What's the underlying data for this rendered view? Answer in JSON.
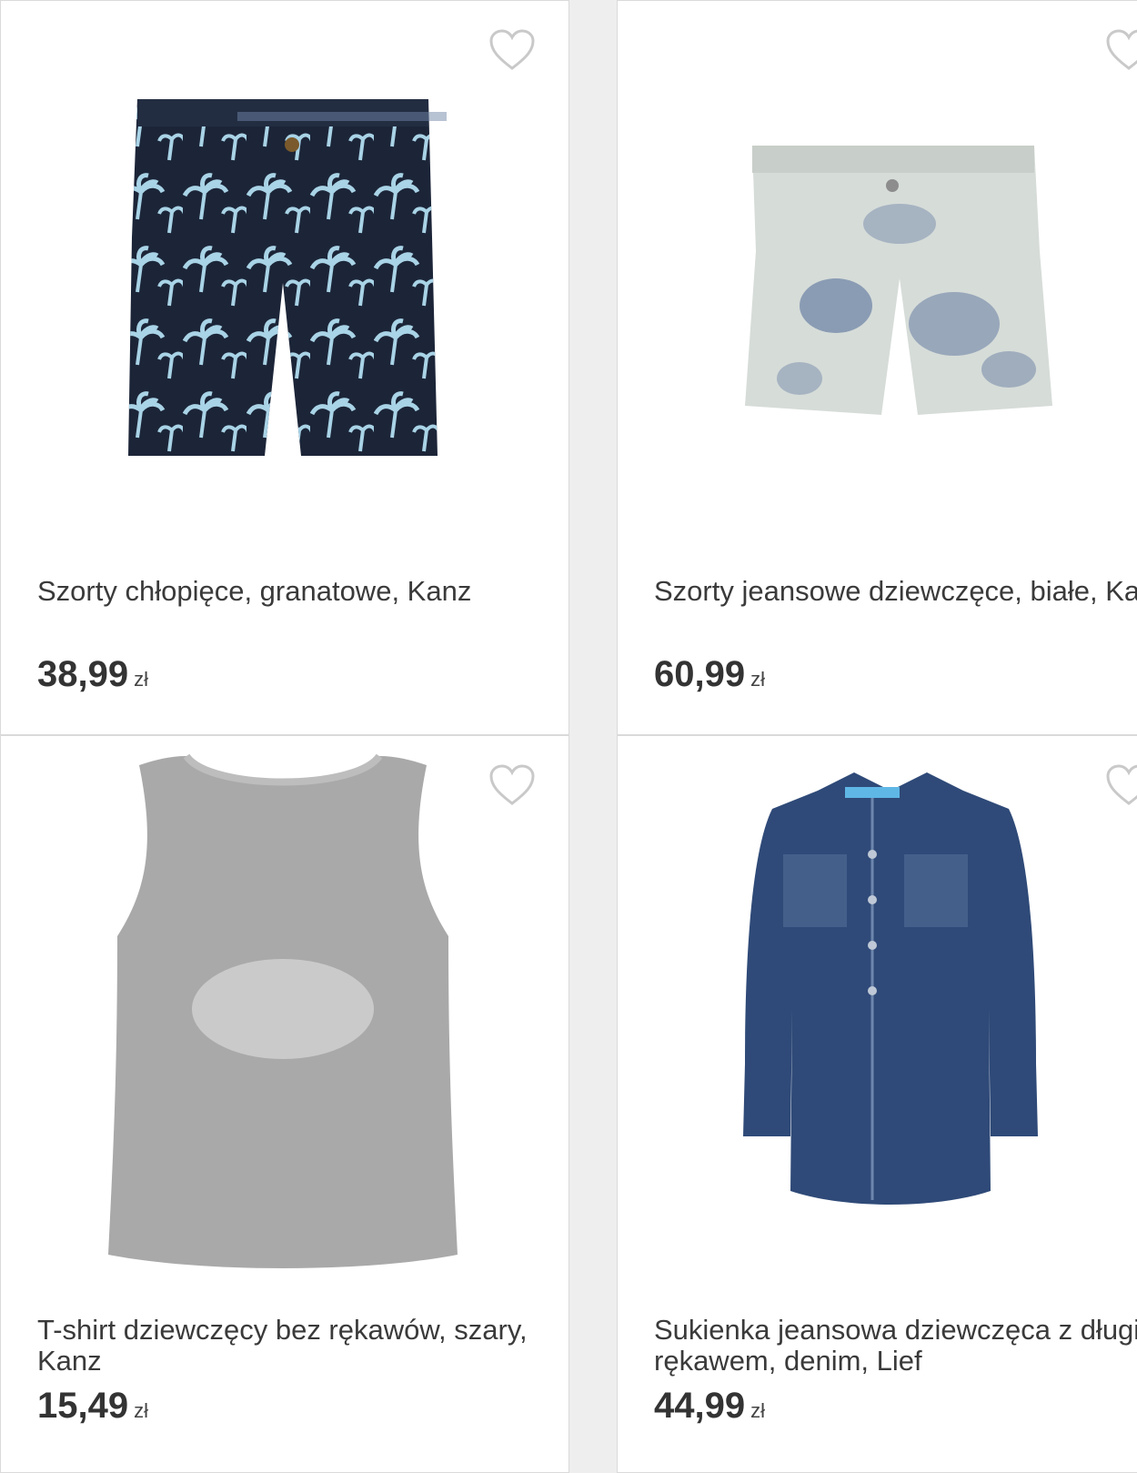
{
  "products": [
    {
      "title": "Szorty chłopięce, granatowe, Kanz",
      "price": "38,99",
      "currency": "zł",
      "image_icon": "shorts-navy-palm-icon",
      "colors": {
        "main": "#1c2538",
        "print": "#a9d3e6"
      }
    },
    {
      "title": "Szorty jeansowe dziewczęce, białe, Kanz",
      "price": "60,99",
      "currency": "zł",
      "image_icon": "shorts-white-denim-icon",
      "colors": {
        "main": "#d6dcd8",
        "print": "#4d6797"
      }
    },
    {
      "title": "T-shirt dziewczęcy bez rękawów, szary, Kanz",
      "price": "15,49",
      "currency": "zł",
      "image_icon": "tank-top-grey-icon",
      "colors": {
        "main": "#a9a9a9",
        "print": "#d8d8d8"
      }
    },
    {
      "title": "Sukienka jeansowa dziewczęca z długim rękawem, denim, Lief",
      "price": "44,99",
      "currency": "zł",
      "image_icon": "denim-dress-icon",
      "colors": {
        "main": "#2f4a78",
        "print": "#6d86ad"
      }
    }
  ],
  "favorite_icon": "heart-outline-icon",
  "accent": {
    "heart": "#c9c9c9",
    "text": "#3a3a3a"
  }
}
